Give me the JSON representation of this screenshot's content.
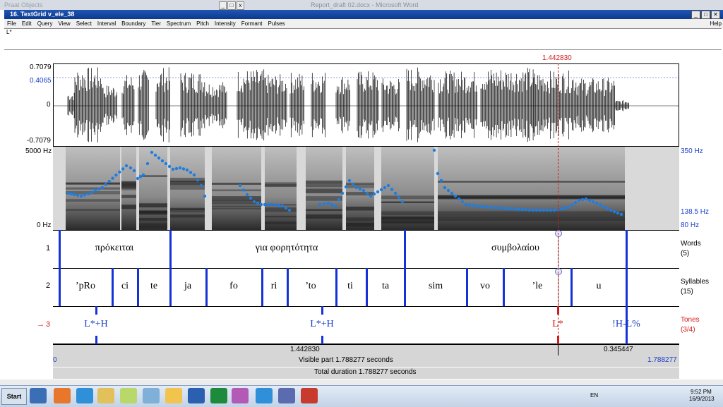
{
  "background": {
    "praat_objects": "Praat Objects",
    "word_title": "Report_draft 02.docx - Microsoft Word"
  },
  "window": {
    "title": "16. TextGrid v_ele_38",
    "help": "Help"
  },
  "menu": [
    "File",
    "Edit",
    "Query",
    "View",
    "Select",
    "Interval",
    "Boundary",
    "Tier",
    "Spectrum",
    "Pitch",
    "Intensity",
    "Formant",
    "Pulses"
  ],
  "text_field": {
    "value": "L*"
  },
  "cursor": {
    "time": "1.442830"
  },
  "waveform": {
    "max": "0.7079",
    "level": "0.4065",
    "zero": "0",
    "min": "-0.7079"
  },
  "spectrogram": {
    "freq_top": "5000 Hz",
    "freq_bottom": "0 Hz",
    "pitch_top": "350 Hz",
    "pitch_value": "138.5 Hz",
    "pitch_bottom": "80 Hz"
  },
  "tiers": [
    {
      "number": "1",
      "name": "Words",
      "count": "(5)",
      "intervals": [
        "πρόκειται",
        "για φορητότητα",
        "συμβολαίου"
      ]
    },
    {
      "number": "2",
      "name": "Syllables",
      "count": "(15)",
      "intervals": [
        "’pRo",
        "ci",
        "te",
        "ja",
        "fo",
        "ri",
        "’to",
        "ti",
        "ta",
        "sim",
        "vo",
        "’le",
        "u"
      ]
    },
    {
      "number": "3",
      "marker": "→",
      "name": "Tones",
      "count": "(3/4)",
      "points": [
        "L*+H",
        "L*+H",
        "L*",
        "!H-L%"
      ]
    }
  ],
  "bottom": {
    "left_time": "1.442830",
    "right_time": "0.345447",
    "visible_start": "0",
    "visible": "Visible part 1.788277 seconds",
    "visible_end": "1.788277",
    "total": "Total duration 1.788277 seconds"
  },
  "taskbar": {
    "start": "Start",
    "lang": "EN",
    "time": "9:52 PM",
    "date": "16/9/2013"
  },
  "colors": {
    "accent_blue": "#1432d6",
    "cursor_red": "#d21c1c",
    "pitch_dots": "#1e7de0"
  }
}
